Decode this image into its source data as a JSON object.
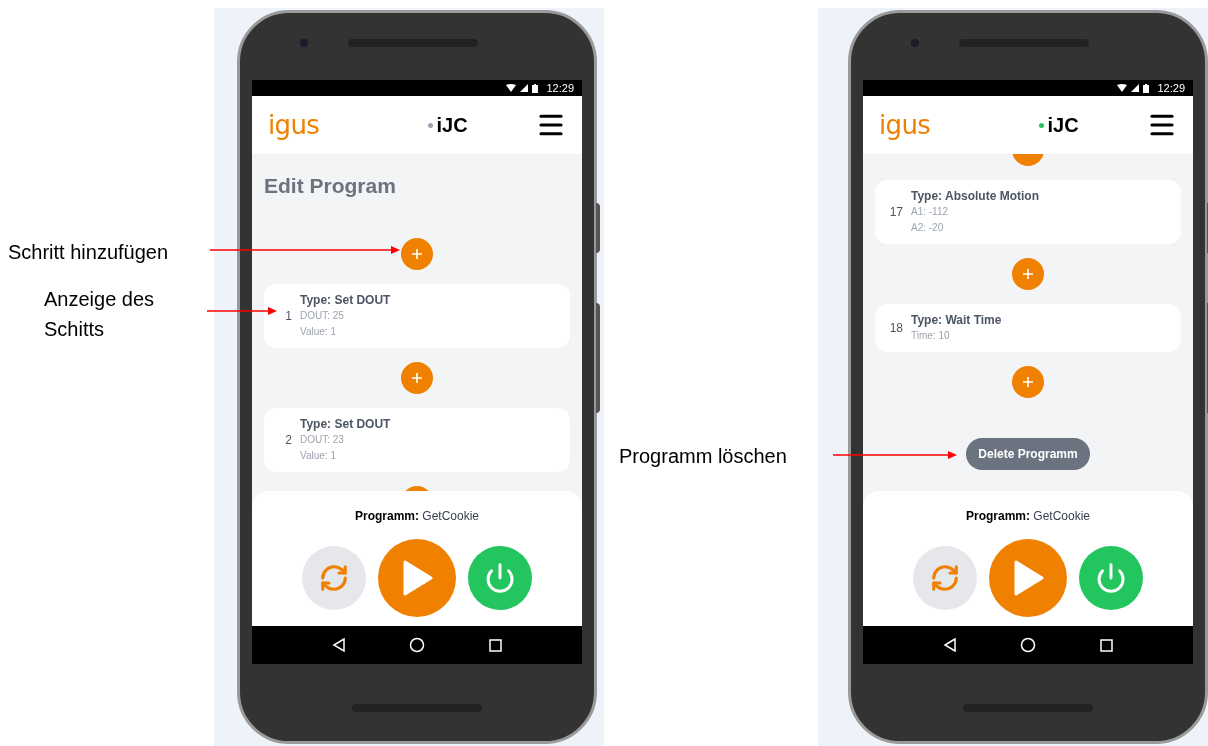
{
  "annotations": [
    {
      "text": "Schritt hinzufügen"
    },
    {
      "text": "Anzeige des Schitts"
    },
    {
      "text": "Programm löschen"
    }
  ],
  "phones": [
    {
      "status_time": "12:29",
      "logo": "igus",
      "app_name": "iJC",
      "connected": false,
      "title": "Edit Program",
      "scrolled": false,
      "steps": [
        {
          "kind": "add"
        },
        {
          "kind": "step",
          "number": "1",
          "type": "Type: Set DOUT",
          "params": [
            "DOUT: 25",
            "Value: 1"
          ]
        },
        {
          "kind": "add"
        },
        {
          "kind": "step",
          "number": "2",
          "type": "Type: Set DOUT",
          "params": [
            "DOUT: 23",
            "Value: 1"
          ]
        },
        {
          "kind": "add_clipped"
        }
      ],
      "program_label": "Programm:",
      "program_name": "GetCookie"
    },
    {
      "status_time": "12:29",
      "logo": "igus",
      "app_name": "iJC",
      "connected": true,
      "scrolled": true,
      "steps": [
        {
          "kind": "add_clipped"
        },
        {
          "kind": "step",
          "number": "17",
          "type": "Type: Absolute Motion",
          "params": [
            "A1: -112",
            "A2: -20"
          ]
        },
        {
          "kind": "add"
        },
        {
          "kind": "step",
          "number": "18",
          "type": "Type: Wait Time",
          "params": [
            "Time: 10"
          ]
        },
        {
          "kind": "add"
        }
      ],
      "delete_button": "Delete Programm",
      "program_label": "Programm:",
      "program_name": "GetCookie"
    }
  ]
}
